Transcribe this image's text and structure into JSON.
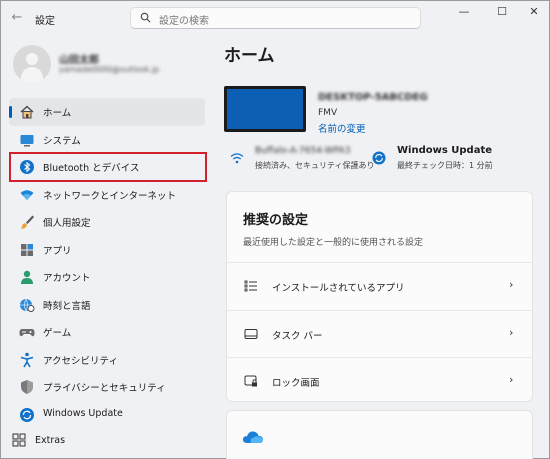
{
  "window": {
    "title": "設定",
    "back_icon": "arrow-left-icon"
  },
  "search": {
    "placeholder": "設定の検索",
    "icon": "search-icon"
  },
  "window_controls": {
    "minimize": "—",
    "maximize": "☐",
    "close": "✕"
  },
  "profile": {
    "name": "山田太郎",
    "email": "yamada0000@outlook.jp"
  },
  "nav": {
    "items": [
      {
        "label": "ホーム",
        "icon": "home-icon",
        "active": true
      },
      {
        "label": "システム",
        "icon": "system-icon"
      },
      {
        "label": "Bluetooth とデバイス",
        "icon": "bluetooth-icon"
      },
      {
        "label": "ネットワークとインターネット",
        "icon": "network-icon"
      },
      {
        "label": "個人用設定",
        "icon": "brush-icon"
      },
      {
        "label": "アプリ",
        "icon": "apps-icon"
      },
      {
        "label": "アカウント",
        "icon": "account-icon"
      },
      {
        "label": "時刻と言語",
        "icon": "globe-clock-icon"
      },
      {
        "label": "ゲーム",
        "icon": "gamepad-icon"
      },
      {
        "label": "アクセシビリティ",
        "icon": "accessibility-icon"
      },
      {
        "label": "プライバシーとセキュリティ",
        "icon": "shield-icon"
      },
      {
        "label": "Windows Update",
        "icon": "windows-update-icon"
      }
    ],
    "extras": {
      "label": "Extras",
      "icon": "extras-icon"
    }
  },
  "main": {
    "title": "ホーム",
    "device": {
      "name": "DESKTOP-5ABCDEG",
      "model": "FMV",
      "rename": "名前の変更"
    },
    "wifi": {
      "name": "Buffalo-A-7654-WPA3",
      "status": "接続済み、セキュリティ保護あり"
    },
    "windows_update": {
      "title": "Windows Update",
      "status": "最終チェック日時：1 分前"
    },
    "recommended": {
      "title": "推奨の設定",
      "subtitle": "最近使用した設定と一般的に使用される設定",
      "items": [
        {
          "label": "インストールされているアプリ",
          "icon": "installed-apps-icon"
        },
        {
          "label": "タスク バー",
          "icon": "taskbar-icon"
        },
        {
          "label": "ロック画面",
          "icon": "lock-screen-icon"
        }
      ]
    },
    "onedrive_icon": "onedrive-cloud-icon"
  },
  "colors": {
    "accent": "#005fb8",
    "highlight_box": "#d2202c",
    "device_screen": "#0c5fb4"
  }
}
